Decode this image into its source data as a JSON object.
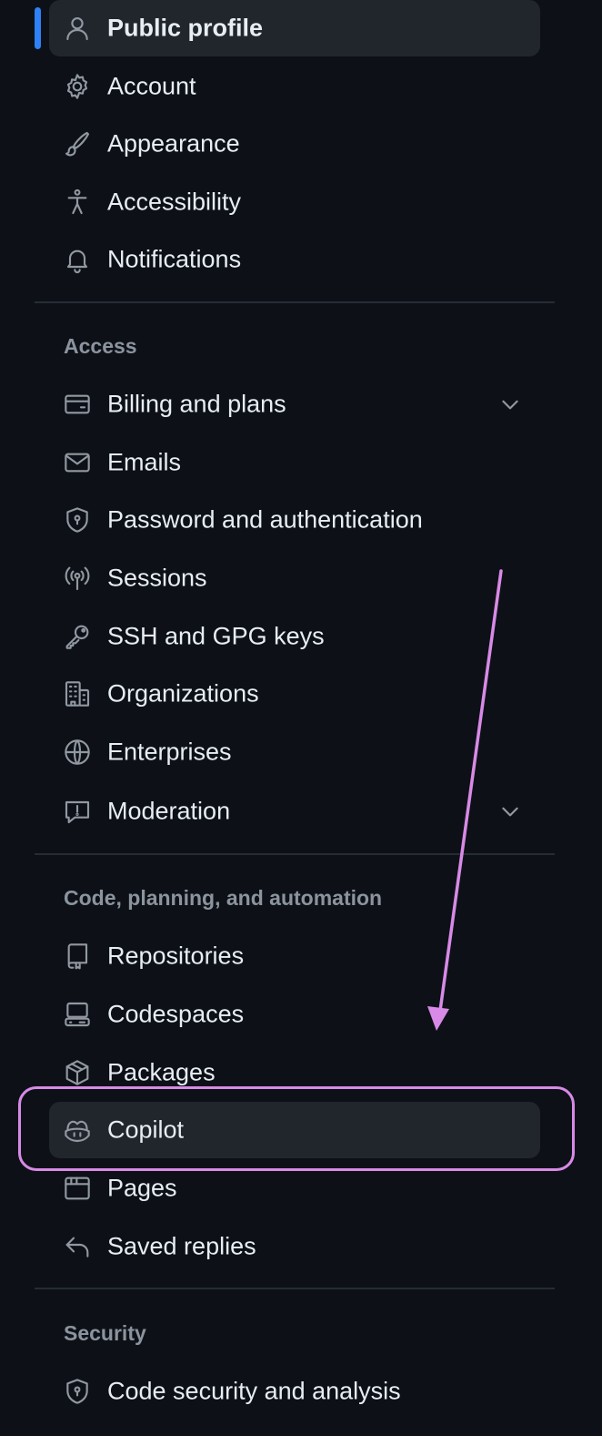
{
  "nav": {
    "items_top": [
      {
        "label": "Public profile",
        "icon": "person-icon",
        "active": true
      },
      {
        "label": "Account",
        "icon": "gear-icon"
      },
      {
        "label": "Appearance",
        "icon": "paintbrush-icon"
      },
      {
        "label": "Accessibility",
        "icon": "accessibility-icon"
      },
      {
        "label": "Notifications",
        "icon": "bell-icon"
      }
    ],
    "access": {
      "heading": "Access",
      "items": [
        {
          "label": "Billing and plans",
          "icon": "credit-card-icon",
          "expandable": true
        },
        {
          "label": "Emails",
          "icon": "mail-icon"
        },
        {
          "label": "Password and authentication",
          "icon": "shield-lock-icon"
        },
        {
          "label": "Sessions",
          "icon": "broadcast-icon"
        },
        {
          "label": "SSH and GPG keys",
          "icon": "key-icon"
        },
        {
          "label": "Organizations",
          "icon": "organization-icon"
        },
        {
          "label": "Enterprises",
          "icon": "globe-icon"
        },
        {
          "label": "Moderation",
          "icon": "report-icon",
          "expandable": true
        }
      ]
    },
    "code": {
      "heading": "Code, planning, and automation",
      "items": [
        {
          "label": "Repositories",
          "icon": "repo-icon"
        },
        {
          "label": "Codespaces",
          "icon": "codespaces-icon"
        },
        {
          "label": "Packages",
          "icon": "package-icon"
        },
        {
          "label": "Copilot",
          "icon": "copilot-icon",
          "highlighted": true
        },
        {
          "label": "Pages",
          "icon": "browser-icon"
        },
        {
          "label": "Saved replies",
          "icon": "reply-icon"
        }
      ]
    },
    "security": {
      "heading": "Security",
      "items": [
        {
          "label": "Code security and analysis",
          "icon": "shield-lock-icon"
        }
      ]
    }
  },
  "colors": {
    "background": "#0d1117",
    "active_indicator": "#2f81f7",
    "annotation": "#d88ae6"
  }
}
